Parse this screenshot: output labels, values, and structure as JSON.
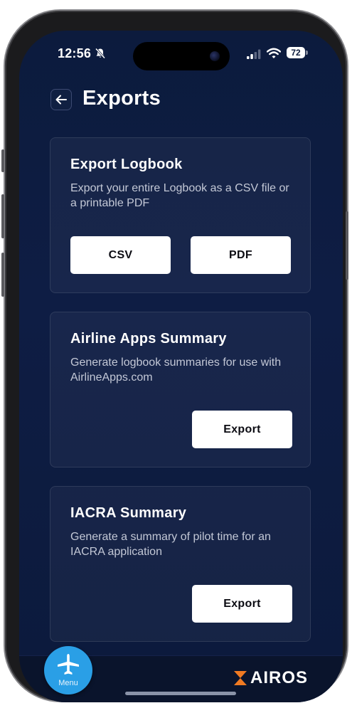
{
  "status_bar": {
    "time": "12:56",
    "battery": "72",
    "icons": [
      "bell-slash-icon",
      "signal-icon",
      "wifi-icon",
      "battery-icon"
    ]
  },
  "header": {
    "back_icon": "arrow-left-icon",
    "title": "Exports"
  },
  "cards": [
    {
      "title": "Export Logbook",
      "description": "Export your entire Logbook as a CSV file or a printable PDF",
      "buttons": [
        "CSV",
        "PDF"
      ]
    },
    {
      "title": "Airline Apps Summary",
      "description": "Generate logbook summaries for use with AirlineApps.com",
      "buttons": [
        "Export"
      ]
    },
    {
      "title": "IACRA Summary",
      "description": "Generate a summary of pilot time for an IACRA application",
      "buttons": [
        "Export"
      ]
    }
  ],
  "bottom_bar": {
    "menu_icon": "airplane-icon",
    "menu_label": "Menu",
    "brand": "AIROS"
  },
  "colors": {
    "background": "#0c1b3d",
    "card": "#1a2548",
    "button": "#ffffff",
    "menu_fab": "#2a9fe6",
    "brand_accent": "#f07a22"
  }
}
